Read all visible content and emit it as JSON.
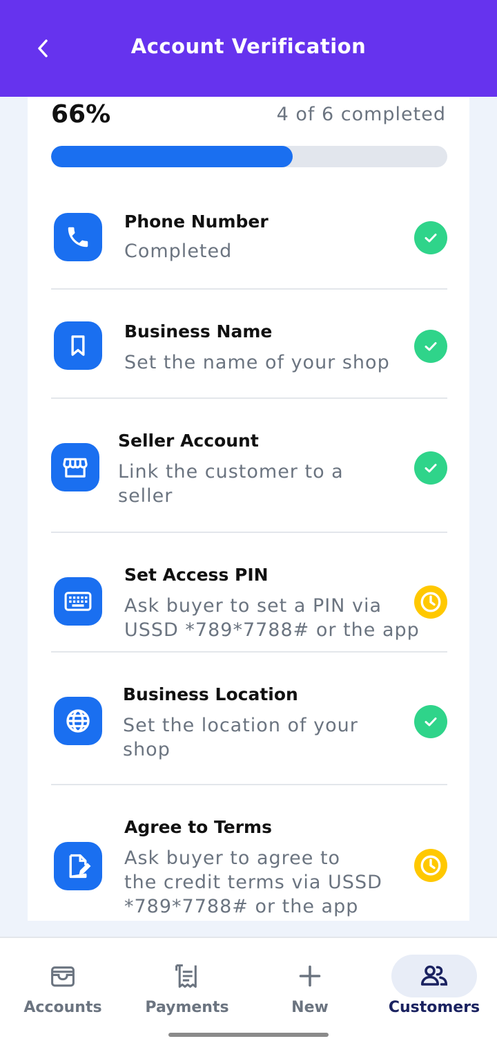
{
  "header": {
    "title": "Account Verification"
  },
  "progress": {
    "percent_label": "66%",
    "count_label": "4 of 6 completed",
    "fraction": 0.61
  },
  "steps": [
    {
      "title": "Phone Number",
      "subtitle": "Completed",
      "icon": "phone-icon",
      "status": "completed"
    },
    {
      "title": "Business Name",
      "subtitle": "Set the name of your shop",
      "icon": "bookmark-icon",
      "status": "completed"
    },
    {
      "title": "Seller Account",
      "subtitle_lines": [
        "Link the customer to a",
        "seller"
      ],
      "icon": "storefront-icon",
      "status": "completed"
    },
    {
      "title": "Set Access PIN",
      "subtitle_lines": [
        "Ask buyer to set a PIN via",
        "USSD *789*7788# or the app"
      ],
      "icon": "keyboard-icon",
      "status": "pending"
    },
    {
      "title": "Business Location",
      "subtitle_lines": [
        "Set the location of your",
        "shop"
      ],
      "icon": "globe-icon",
      "status": "completed"
    },
    {
      "title": "Agree to Terms",
      "subtitle_lines": [
        "Ask buyer to agree to",
        "the credit terms via USSD",
        "*789*7788# or the app"
      ],
      "icon": "document-edit-icon",
      "status": "pending"
    }
  ],
  "nav": {
    "items": [
      {
        "label": "Accounts",
        "icon": "wallet-icon",
        "active": false
      },
      {
        "label": "Payments",
        "icon": "receipt-icon",
        "active": false
      },
      {
        "label": "New",
        "icon": "plus-icon",
        "active": false
      },
      {
        "label": "Customers",
        "icon": "users-icon",
        "active": true
      }
    ]
  },
  "colors": {
    "header": "#6633ee",
    "accent": "#1a6ff0",
    "done": "#2fd48a",
    "pending": "#ffc800"
  }
}
